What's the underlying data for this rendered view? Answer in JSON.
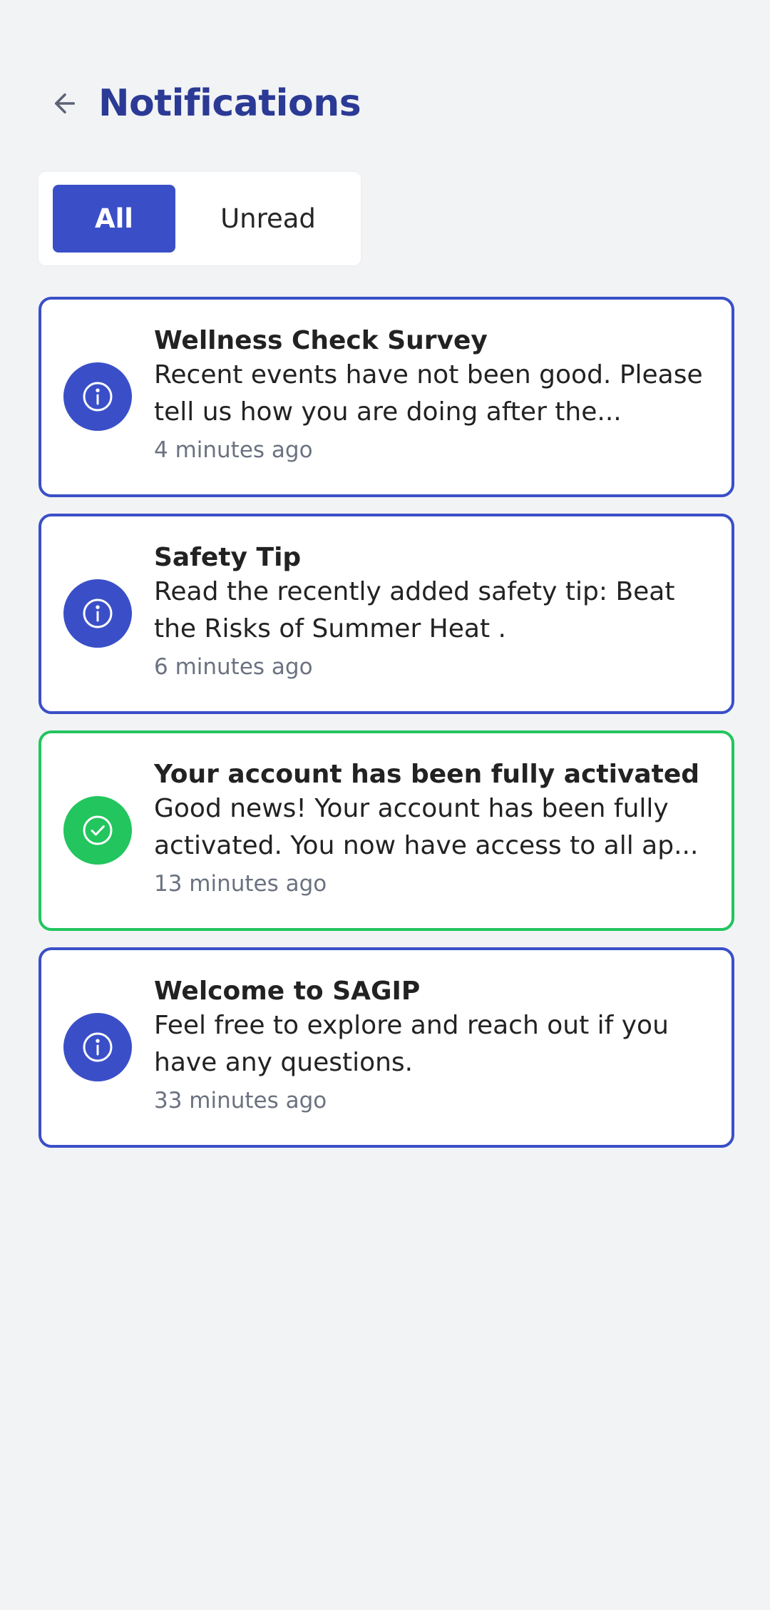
{
  "header": {
    "title": "Notifications",
    "back_icon": "arrow-left-icon"
  },
  "tabs": [
    {
      "label": "All",
      "selected": true
    },
    {
      "label": "Unread",
      "selected": false
    }
  ],
  "notifications": [
    {
      "title": "Wellness Check Survey",
      "message": "Recent events have not been good. Please tell us how you are doing after the...",
      "time": "4 minutes ago",
      "icon": "info-icon",
      "color": "#3a4fc7"
    },
    {
      "title": "Safety Tip",
      "message": "Read the recently added safety tip: Beat the Risks of Summer Heat .",
      "time": "6 minutes ago",
      "icon": "info-icon",
      "color": "#3a4fc7"
    },
    {
      "title": "Your account has been fully activated",
      "message": "Good news! Your account has been fully activated. You now have access to all ap...",
      "time": "13 minutes ago",
      "icon": "check-circle-icon",
      "color": "#22c55e"
    },
    {
      "title": "Welcome to SAGIP",
      "message": "Feel free to explore and reach out if you have any questions.",
      "time": "33 minutes ago",
      "icon": "info-icon",
      "color": "#3a4fc7"
    }
  ],
  "colors": {
    "accent": "#3a4fc7",
    "title": "#2b3a95",
    "success": "#22c55e",
    "background": "#f2f3f5",
    "muted_text": "#6b7280"
  }
}
